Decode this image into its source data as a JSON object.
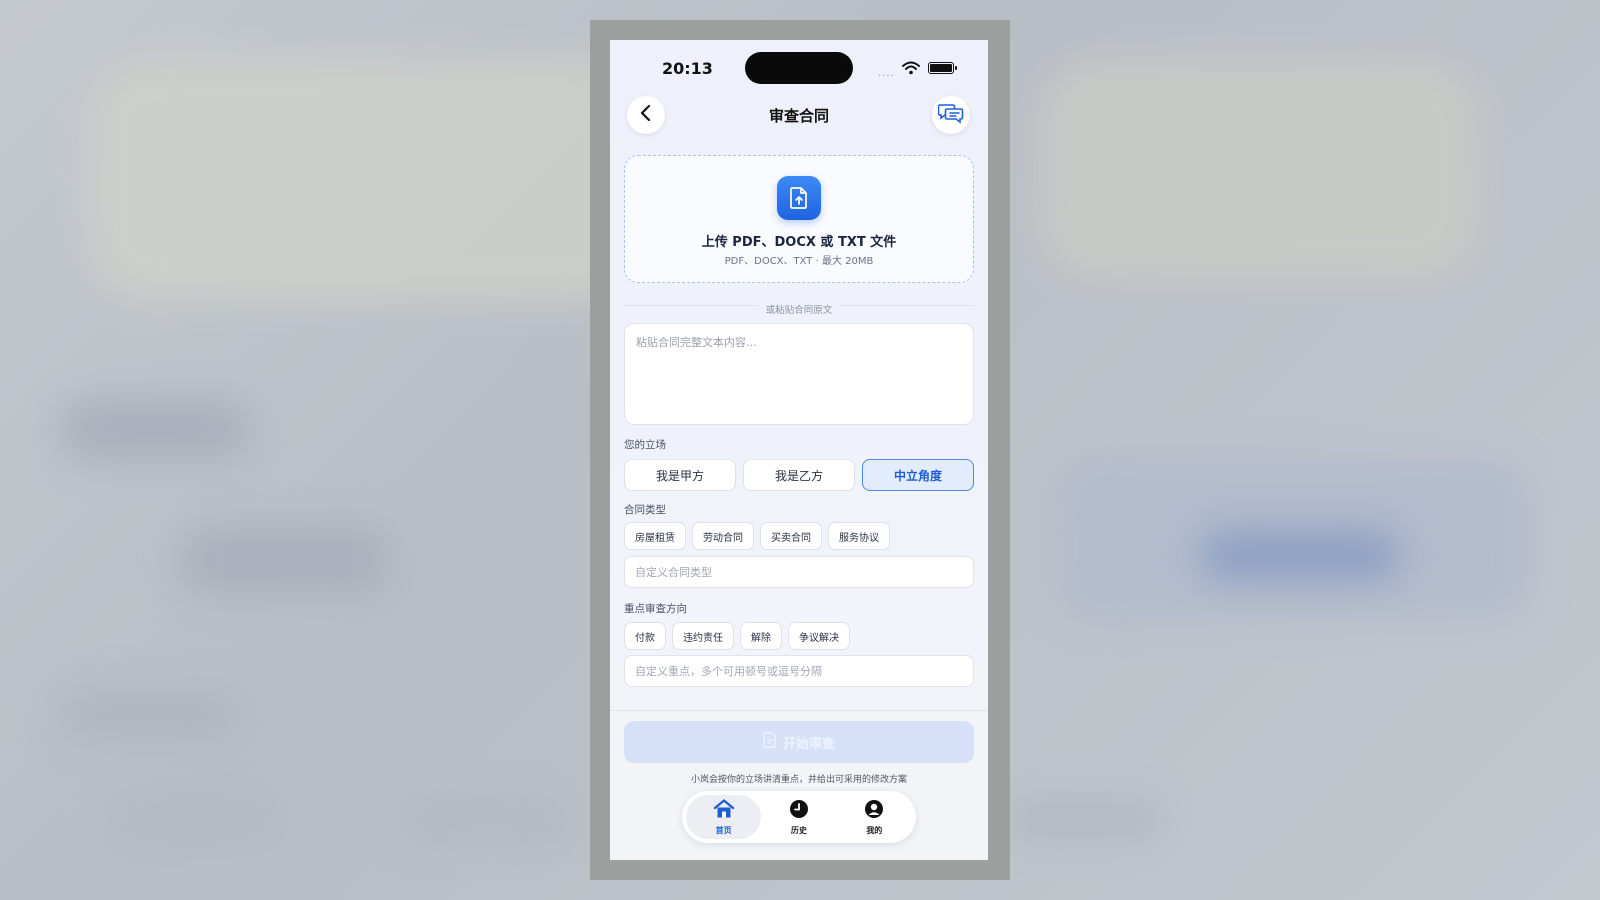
{
  "status_bar": {
    "time": "20:13",
    "signal": "...."
  },
  "nav": {
    "title": "审查合同",
    "back_icon": "chevron-left-icon",
    "chat_icon": "chat-bubbles-icon"
  },
  "upload": {
    "icon": "file-upload-icon",
    "title": "上传 PDF、DOCX 或 TXT 文件",
    "subtitle": "PDF、DOCX、TXT · 最大 20MB"
  },
  "divider_text": "或粘贴合同原文",
  "paste": {
    "placeholder": "粘贴合同完整文本内容..."
  },
  "stance": {
    "label": "您的立场",
    "options": [
      "我是甲方",
      "我是乙方",
      "中立角度"
    ],
    "selected": "中立角度"
  },
  "contract_type": {
    "label": "合同类型",
    "chips": [
      "房屋租赁",
      "劳动合同",
      "买卖合同",
      "服务协议"
    ],
    "custom_placeholder": "自定义合同类型"
  },
  "focus": {
    "label": "重点审查方向",
    "chips": [
      "付款",
      "违约责任",
      "解除",
      "争议解决"
    ],
    "custom_placeholder": "自定义重点，多个可用顿号或逗号分隔"
  },
  "actions": {
    "start_label": "开始审查",
    "start_icon": "document-icon",
    "hint": "小岚会按你的立场讲清重点，并给出可采用的修改方案"
  },
  "tabbar": {
    "items": [
      {
        "label": "首页",
        "icon": "home-icon",
        "active": true
      },
      {
        "label": "历史",
        "icon": "clock-icon",
        "active": false
      },
      {
        "label": "我的",
        "icon": "profile-icon",
        "active": false
      }
    ]
  },
  "colors": {
    "accent": "#1f5fd6",
    "active_chip_bg": "#e3ecfd",
    "disabled_button": "#d6e1f8"
  }
}
